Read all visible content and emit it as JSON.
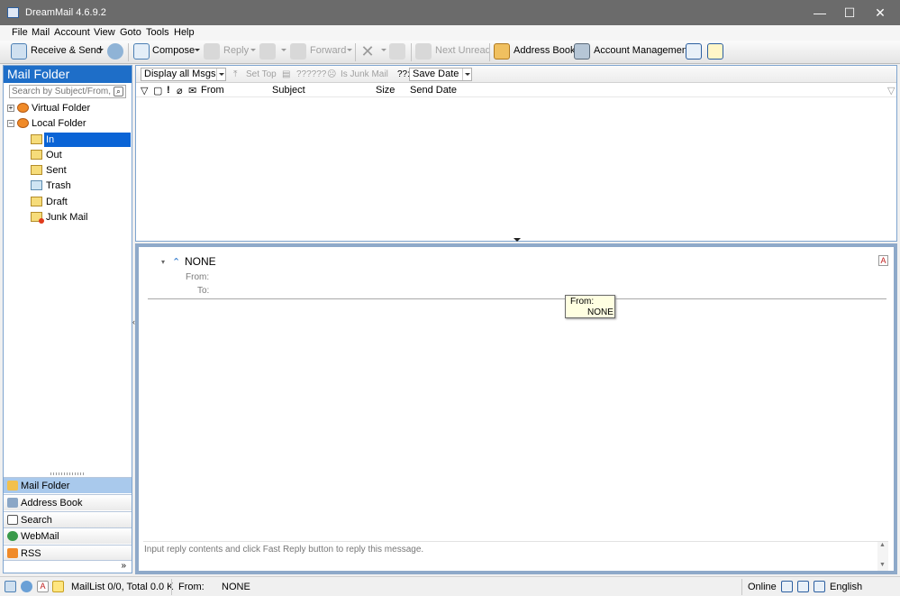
{
  "window": {
    "title": "DreamMail 4.6.9.2",
    "minimize": "—",
    "maximize": "☐",
    "close": "✕"
  },
  "menu": [
    "File",
    "Mail",
    "Account",
    "View",
    "Goto",
    "Tools",
    "Help"
  ],
  "toolbar": {
    "receive_send": "Receive & Send",
    "compose": "Compose",
    "reply": "Reply",
    "forward": "Forward",
    "next_unread": "Next Unread",
    "address_book": "Address Book",
    "account_management": "Account Management"
  },
  "sidebar": {
    "title": "Mail Folder",
    "search_placeholder": "Search by Subject/From,",
    "tree": {
      "virtual_folder": "Virtual Folder",
      "local_folder": "Local Folder",
      "folders": [
        "In",
        "Out",
        "Sent",
        "Trash",
        "Draft",
        "Junk Mail"
      ]
    },
    "nav": [
      "Mail Folder",
      "Address Book",
      "Search",
      "WebMail",
      "RSS"
    ],
    "nav_more": "»"
  },
  "list": {
    "filter": "Display all Msgs",
    "set_top": "Set Top",
    "unknown_action": "??????",
    "is_junk": "Is Junk Mail",
    "sort_prefix": "??:",
    "sort_by": "Save Date",
    "columns": {
      "from": "From",
      "subject": "Subject",
      "size": "Size",
      "send_date": "Send Date"
    }
  },
  "preview": {
    "subject": "NONE",
    "from_label": "From:",
    "to_label": "To:",
    "tooltip_label": "From:",
    "tooltip_value": "NONE",
    "reply_placeholder": "Input reply contents and click Fast Reply button to reply this message."
  },
  "status": {
    "maillist": "MailList 0/0, Total 0.0 K",
    "from_label": "From:",
    "from_value": "NONE",
    "online": "Online",
    "language": "English"
  }
}
